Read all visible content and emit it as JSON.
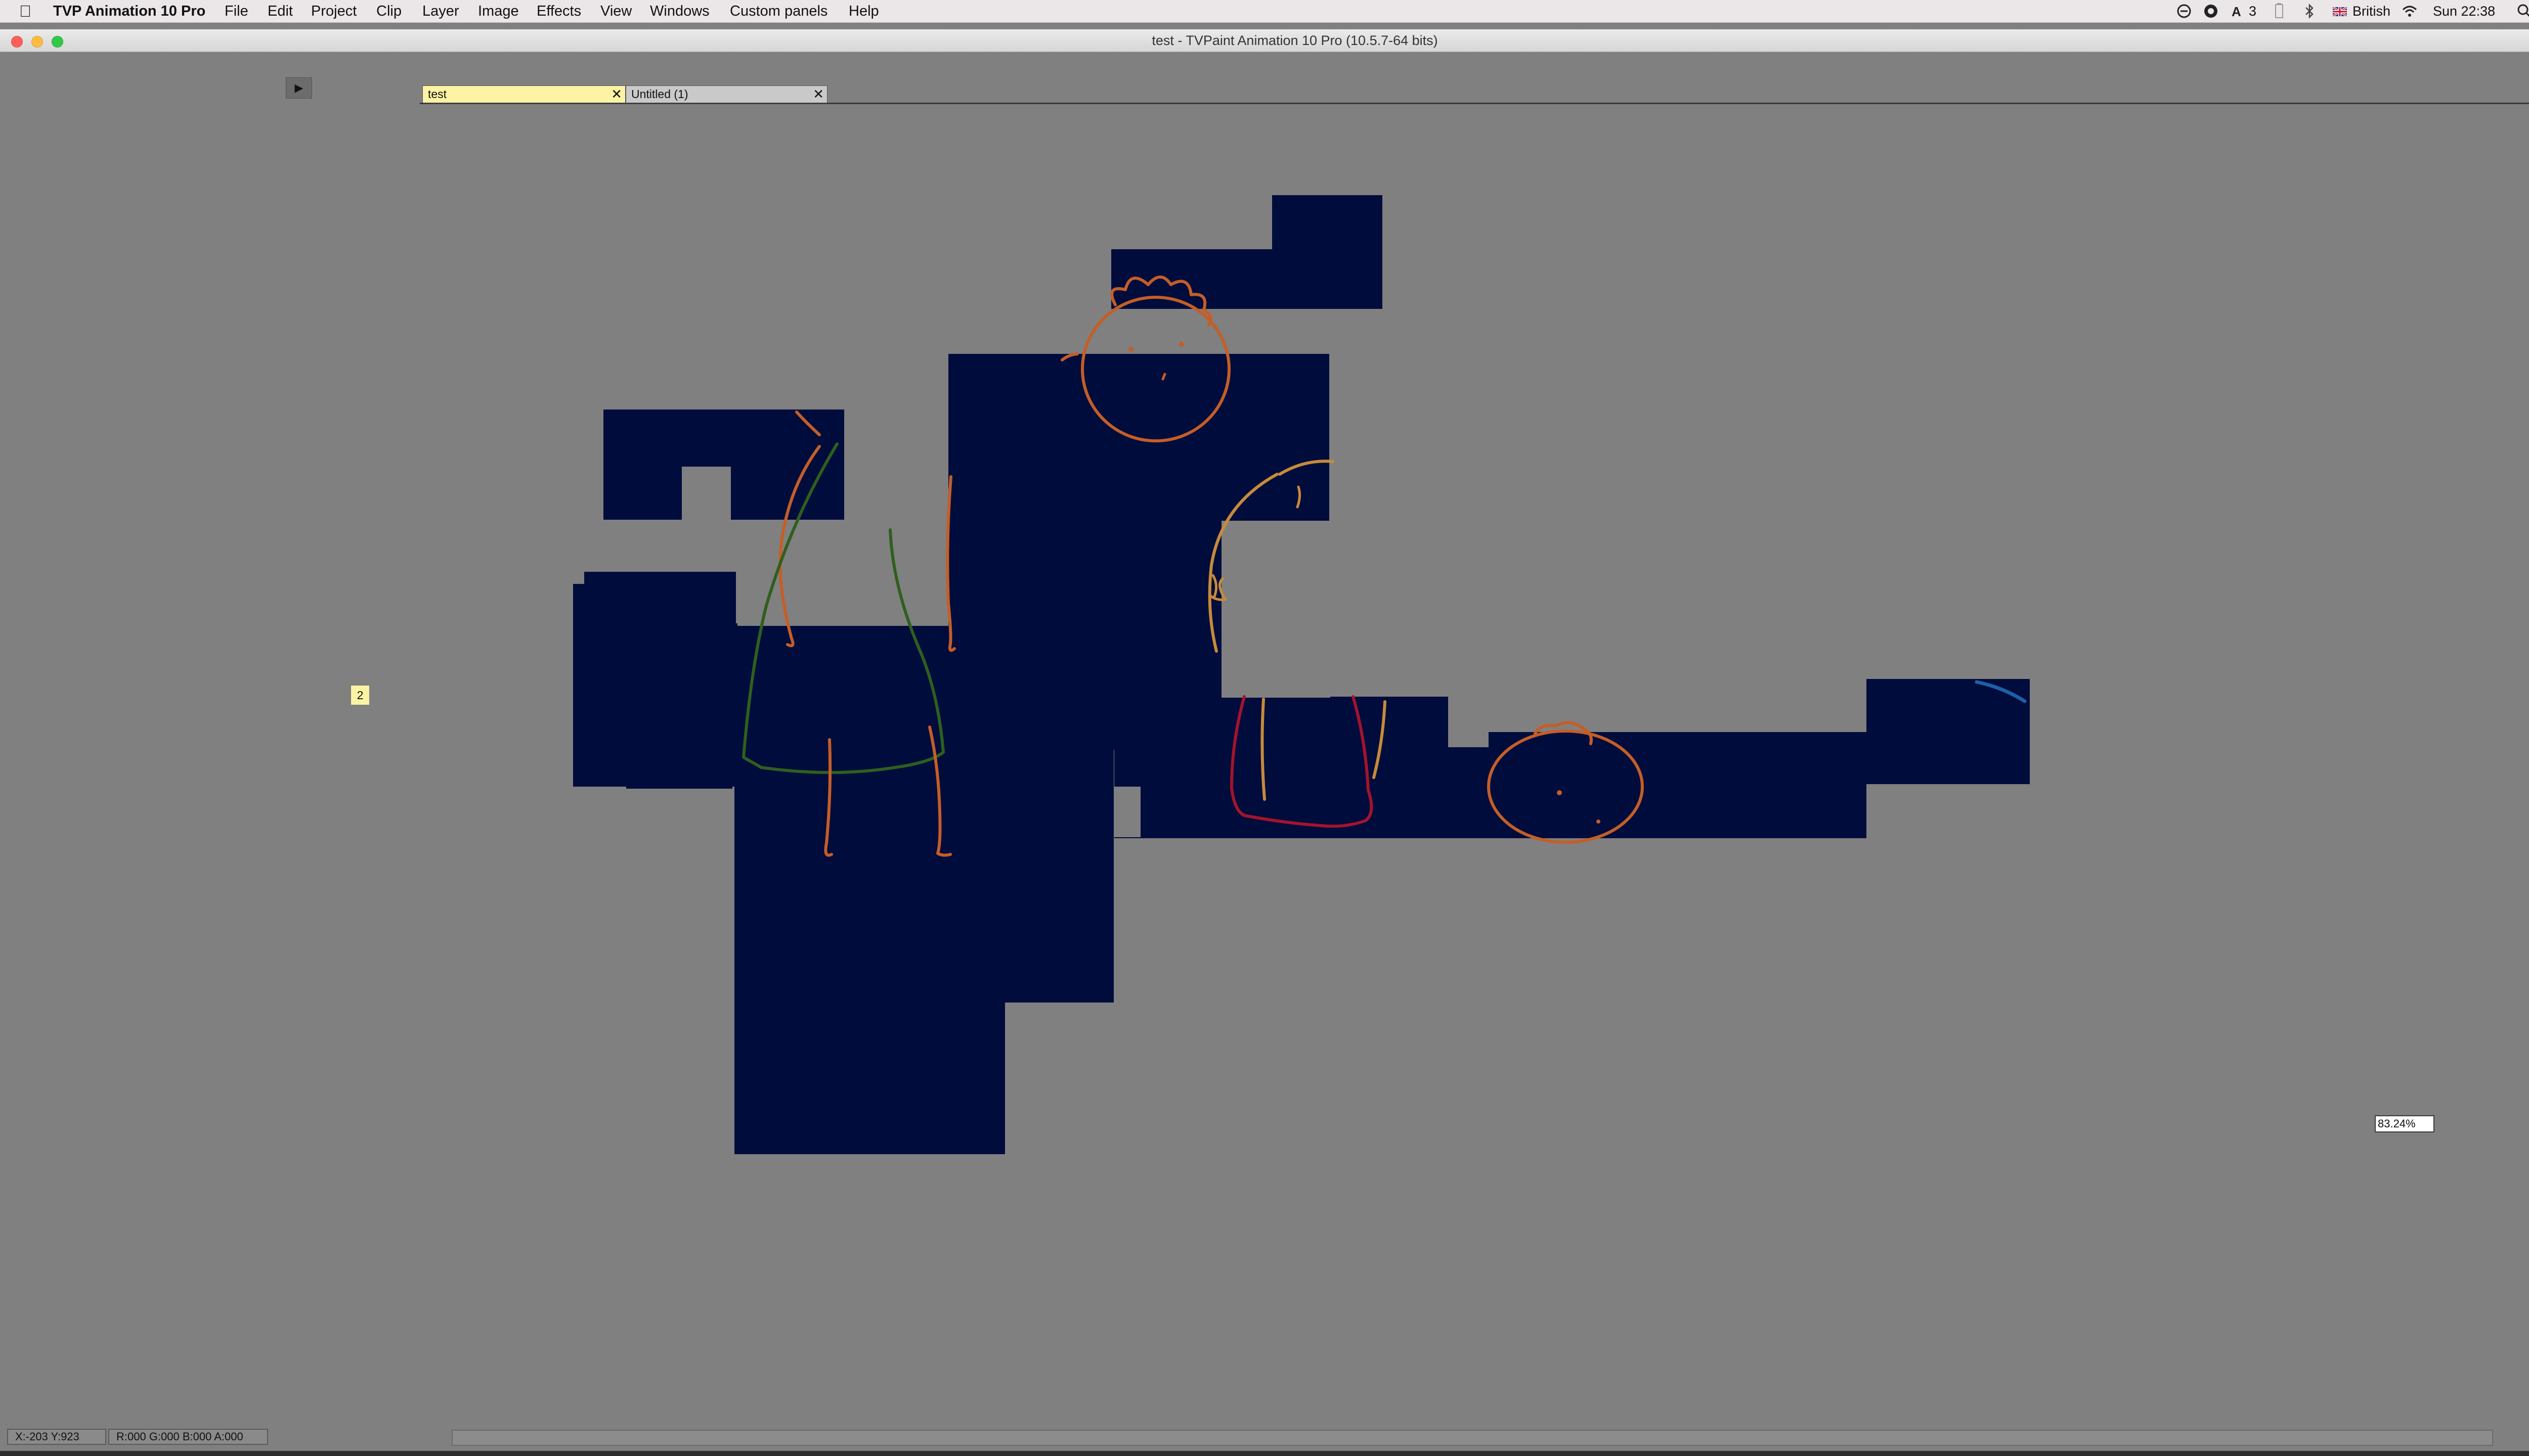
{
  "menubar": {
    "app_name": "TVP Animation 10 Pro",
    "menus": [
      "File",
      "Edit",
      "Project",
      "Clip",
      "Layer",
      "Image",
      "Effects",
      "View",
      "Windows",
      "Custom panels",
      "Help"
    ],
    "status": {
      "notification_count": "3",
      "input_source": "British",
      "clock": "Sun 22:38"
    },
    "icons": [
      "apple-icon",
      "timer-icon",
      "record-icon",
      "keyboard-viewer-icon",
      "battery-icon",
      "bluetooth-icon",
      "flag-icon",
      "wifi-icon",
      "spotlight-icon",
      "notification-center-icon"
    ]
  },
  "window": {
    "title": "test - TVPaint Animation 10 Pro (10.5.7-64 bits)"
  },
  "tabs": [
    {
      "label": "test",
      "active": true
    },
    {
      "label": "Untitled (1)",
      "active": false
    }
  ],
  "controls": {
    "play_glyph": "▶",
    "close_glyph": "✕",
    "dropdown_glyph": "▼"
  },
  "canvas": {
    "layer_badge": "2",
    "zoom": "83.24%",
    "background_color": "#808080",
    "paint_color": "#000c3c",
    "stroke_colors": {
      "orange": "#c45e27",
      "tan": "#c78a3b",
      "green": "#2f5f1e",
      "red": "#a3142c",
      "blue": "#1f5fa9"
    }
  },
  "statusbar": {
    "coords": "X:-203  Y:923",
    "rgba": "R:000 G:000 B:000 A:000"
  }
}
